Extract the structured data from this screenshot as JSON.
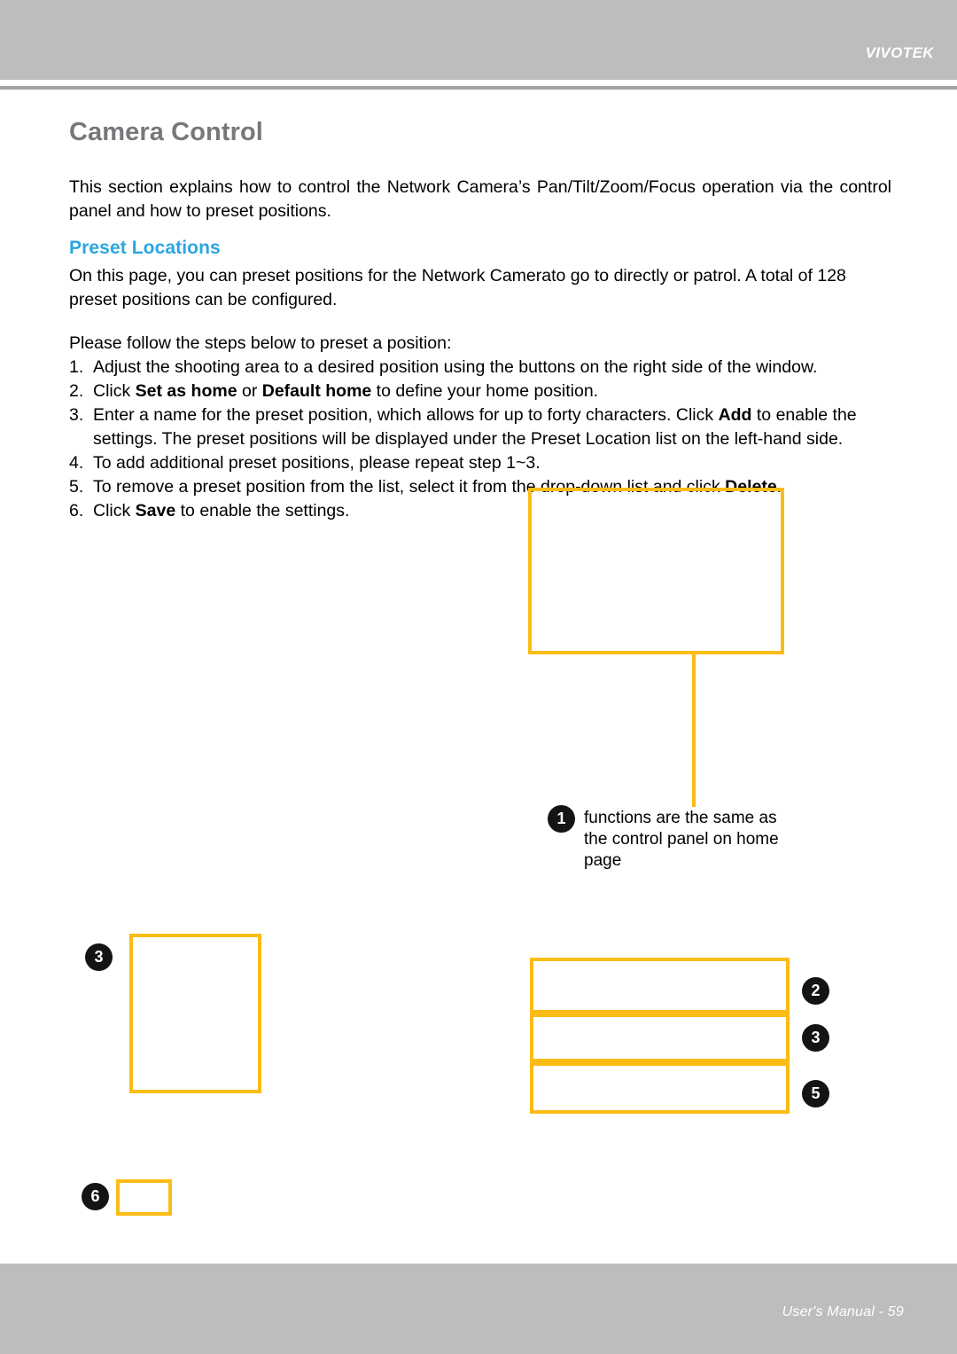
{
  "header": {
    "brand": "VIVOTEK"
  },
  "page": {
    "title": "Camera Control",
    "intro": "This section explains how to control the Network Camera’s Pan/Tilt/Zoom/Focus operation via the control panel and how to preset positions.",
    "section_heading": "Preset Locations",
    "section_paragraph": "On this page, you can preset positions for the Network Camerato go to directly or patrol. A total of 128 preset positions can be configured.",
    "steps_lead": "Please follow the steps below to preset a position:",
    "steps": [
      {
        "num": "1.",
        "parts": [
          {
            "text": "Adjust the shooting area to a desired position using the buttons on the right side of the window.",
            "bold": false
          }
        ]
      },
      {
        "num": "2.",
        "parts": [
          {
            "text": "Click ",
            "bold": false
          },
          {
            "text": "Set as home",
            "bold": true
          },
          {
            "text": " or ",
            "bold": false
          },
          {
            "text": "Default home",
            "bold": true
          },
          {
            "text": " to define your home position.",
            "bold": false
          }
        ]
      },
      {
        "num": "3.",
        "parts": [
          {
            "text": "Enter a name for the preset position, which allows for up to forty characters. Click ",
            "bold": false
          },
          {
            "text": "Add",
            "bold": true
          },
          {
            "text": " to enable the settings. The preset positions will be displayed under the Preset Location list on the left-hand side.",
            "bold": false
          }
        ]
      },
      {
        "num": "4.",
        "parts": [
          {
            "text": "To add additional preset positions, please repeat step 1~3.",
            "bold": false
          }
        ]
      },
      {
        "num": "5.",
        "parts": [
          {
            "text": "To remove a preset position from the list, select it from the drop-down list and click ",
            "bold": false
          },
          {
            "text": "Delete",
            "bold": true
          },
          {
            "text": ".",
            "bold": false
          }
        ]
      },
      {
        "num": "6.",
        "parts": [
          {
            "text": "Click ",
            "bold": false
          },
          {
            "text": "Save",
            "bold": true
          },
          {
            "text": " to enable the settings.",
            "bold": false
          }
        ]
      }
    ]
  },
  "diagram": {
    "callouts": {
      "one": "1",
      "two": "2",
      "three_left": "3",
      "three_right": "3",
      "five": "5",
      "six": "6"
    },
    "note_one": "functions are the same as the control panel on home page",
    "accent_color": "#fbbc16"
  },
  "footer": {
    "text": "User's Manual - 59"
  }
}
